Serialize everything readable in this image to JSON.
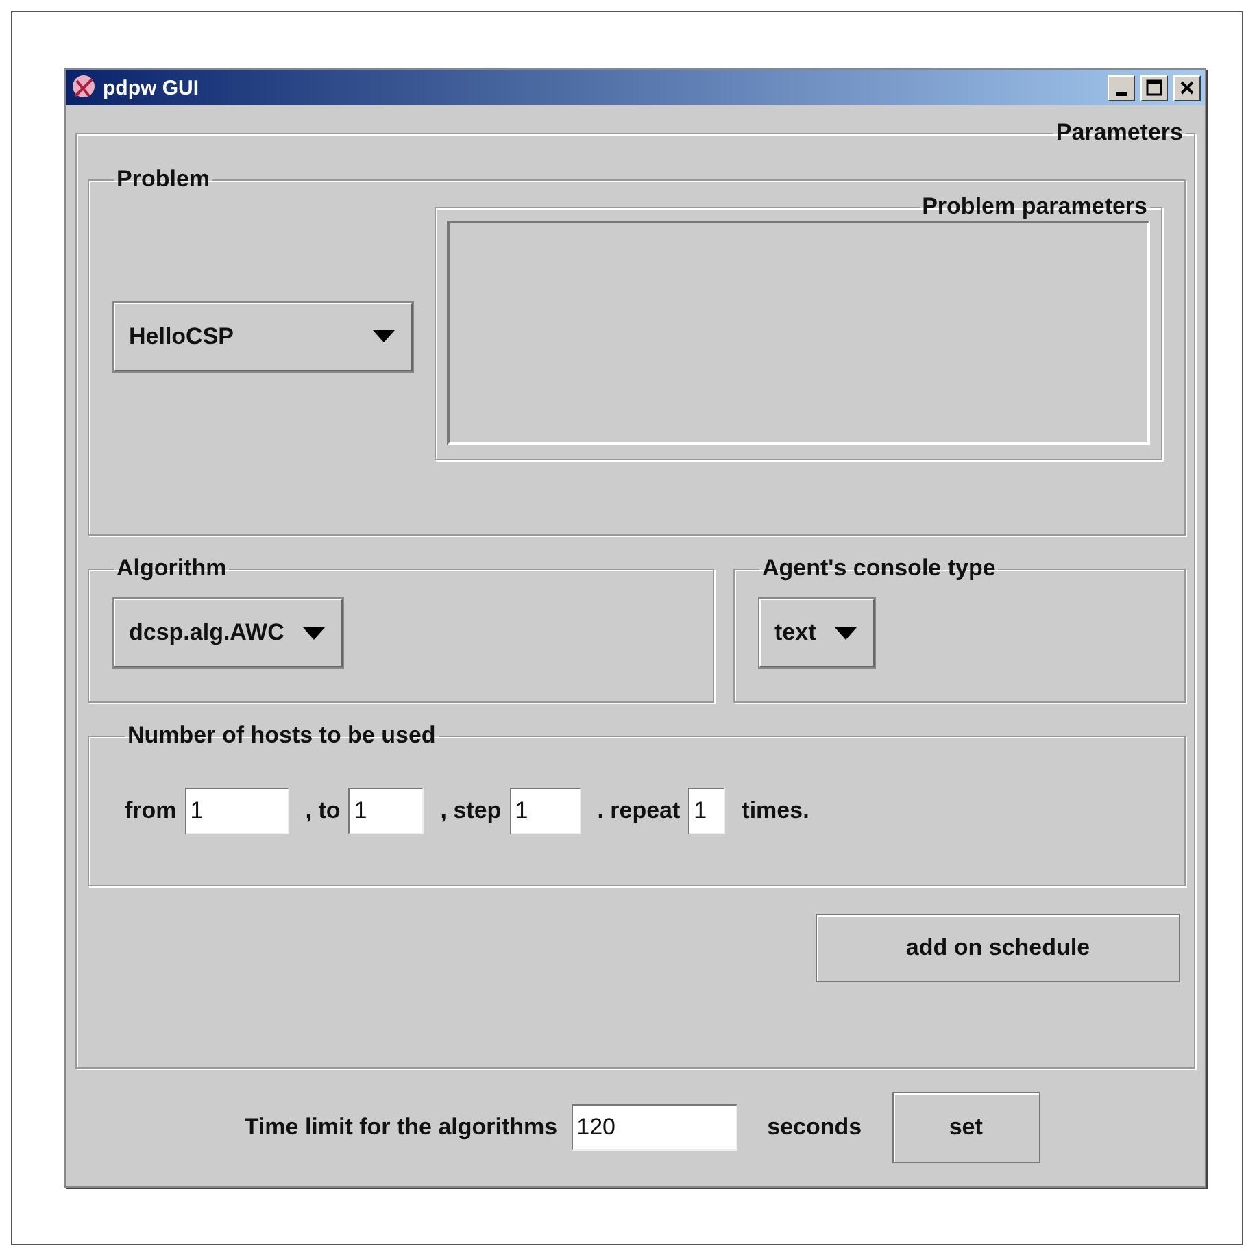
{
  "window": {
    "title": "pdpw GUI"
  },
  "parameters": {
    "title": "Parameters",
    "problem": {
      "title": "Problem",
      "selected_problem": "HelloCSP",
      "parameters_title": "Problem parameters"
    },
    "algorithm": {
      "title": "Algorithm",
      "value": "dcsp.alg.AWC"
    },
    "console": {
      "title": "Agent's console type",
      "value": "text"
    },
    "hosts": {
      "title": "Number of hosts to be used",
      "fields": [
        {
          "label": "from",
          "value": "1"
        },
        {
          "label": ", to",
          "value": "1"
        },
        {
          "label": ", step",
          "value": "1"
        },
        {
          "label": ". repeat",
          "value": "1"
        }
      ],
      "suffix": "times."
    },
    "add_button": "add on schedule"
  },
  "time_limit": {
    "label": "Time limit for the algorithms",
    "value": "120",
    "unit": "seconds",
    "button": "set"
  }
}
